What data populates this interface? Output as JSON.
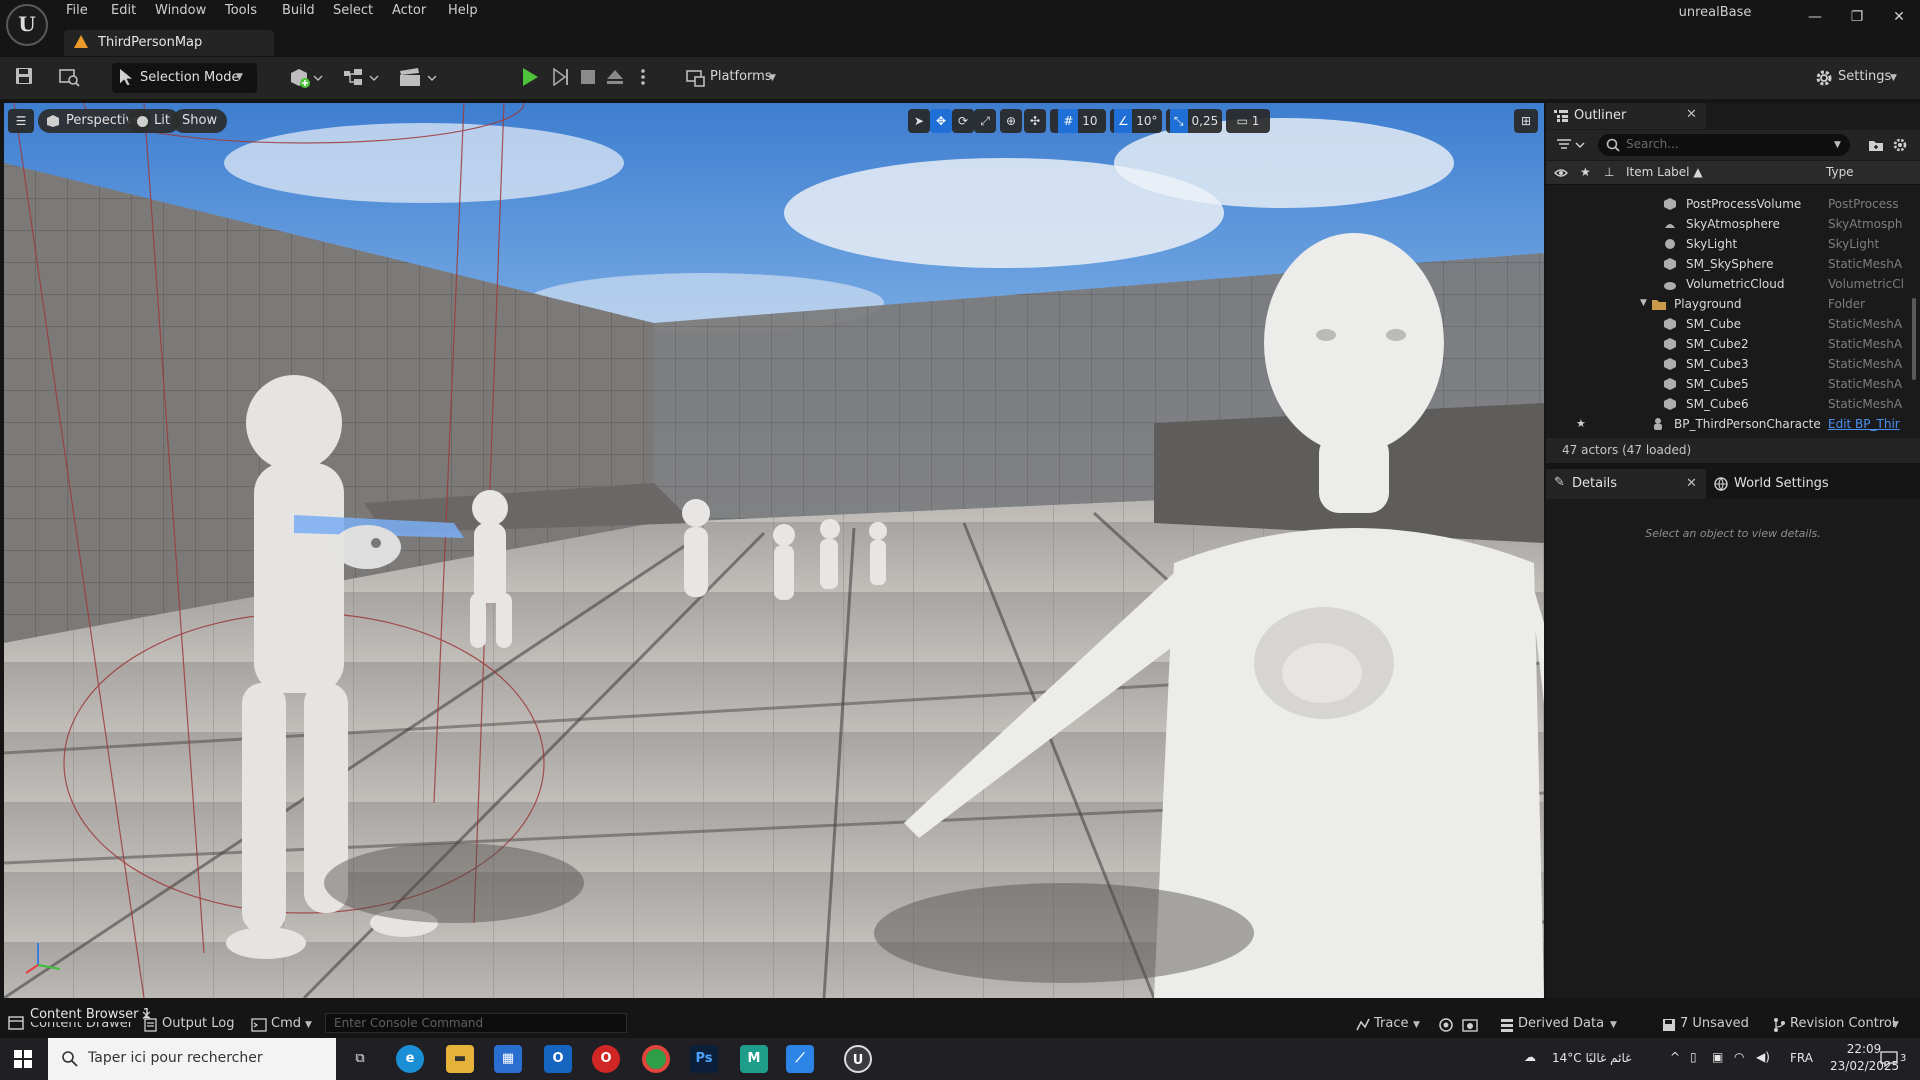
{
  "menu": {
    "items": [
      "File",
      "Edit",
      "Window",
      "Tools",
      "Build",
      "Select",
      "Actor",
      "Help"
    ],
    "app_title": "unrealBase",
    "logo_text": "U"
  },
  "window_controls": {
    "minimize": "—",
    "restore": "❐",
    "close": "✕"
  },
  "doc_tab": {
    "label": "ThirdPersonMap"
  },
  "toolbar": {
    "selection_mode": "Selection Mode",
    "platforms": "Platforms",
    "settings": "Settings",
    "colors": {
      "play": "#4fc33a"
    }
  },
  "viewport": {
    "view_mode": "Perspective",
    "lighting": "Lit",
    "show": "Show",
    "grid_snap": "10",
    "rotation_snap": "10°",
    "scale_snap": "0,25",
    "camera_speed": "1",
    "colors": {
      "snap_active": "#1f6fd6"
    }
  },
  "outliner": {
    "title": "Outliner",
    "search_placeholder": "Search...",
    "col_label": "Item Label ▲",
    "col_type": "Type",
    "rows": [
      {
        "label": "PostProcessVolume",
        "type": "PostProcess",
        "icon": "cube-icon"
      },
      {
        "label": "SkyAtmosphere",
        "type": "SkyAtmosph",
        "icon": "sky-icon"
      },
      {
        "label": "SkyLight",
        "type": "SkyLight",
        "icon": "light-icon"
      },
      {
        "label": "SM_SkySphere",
        "type": "StaticMeshA",
        "icon": "cube-icon"
      },
      {
        "label": "VolumetricCloud",
        "type": "VolumetricCl",
        "icon": "cloud-icon"
      },
      {
        "label": "Playground",
        "type": "Folder",
        "icon": "folder-icon"
      },
      {
        "label": "SM_Cube",
        "type": "StaticMeshA",
        "icon": "cube-icon"
      },
      {
        "label": "SM_Cube2",
        "type": "StaticMeshA",
        "icon": "cube-icon"
      },
      {
        "label": "SM_Cube3",
        "type": "StaticMeshA",
        "icon": "cube-icon"
      },
      {
        "label": "SM_Cube5",
        "type": "StaticMeshA",
        "icon": "cube-icon"
      },
      {
        "label": "SM_Cube6",
        "type": "StaticMeshA",
        "icon": "cube-icon"
      },
      {
        "label": "BP_ThirdPersonCharacte",
        "type": "Edit BP_Thir",
        "icon": "pawn-icon"
      }
    ],
    "status": "47 actors (47 loaded)"
  },
  "details": {
    "title": "Details",
    "world_settings": "World Settings",
    "empty_message": "Select an object to view details."
  },
  "statusbar": {
    "content_drawer": "Content Drawer",
    "content_browser_tooltip": "Content Browser 1",
    "output_log": "Output Log",
    "cmd": "Cmd",
    "console_placeholder": "Enter Console Command",
    "trace": "Trace",
    "derived_data": "Derived Data",
    "unsaved": "7 Unsaved",
    "revision_control": "Revision Control"
  },
  "taskbar": {
    "search_placeholder": "Taper ici pour rechercher",
    "weather": "14°C  غائم غالبًا",
    "language": "FRA",
    "time": "22:09",
    "date": "23/02/2025",
    "notification_count": "3"
  }
}
